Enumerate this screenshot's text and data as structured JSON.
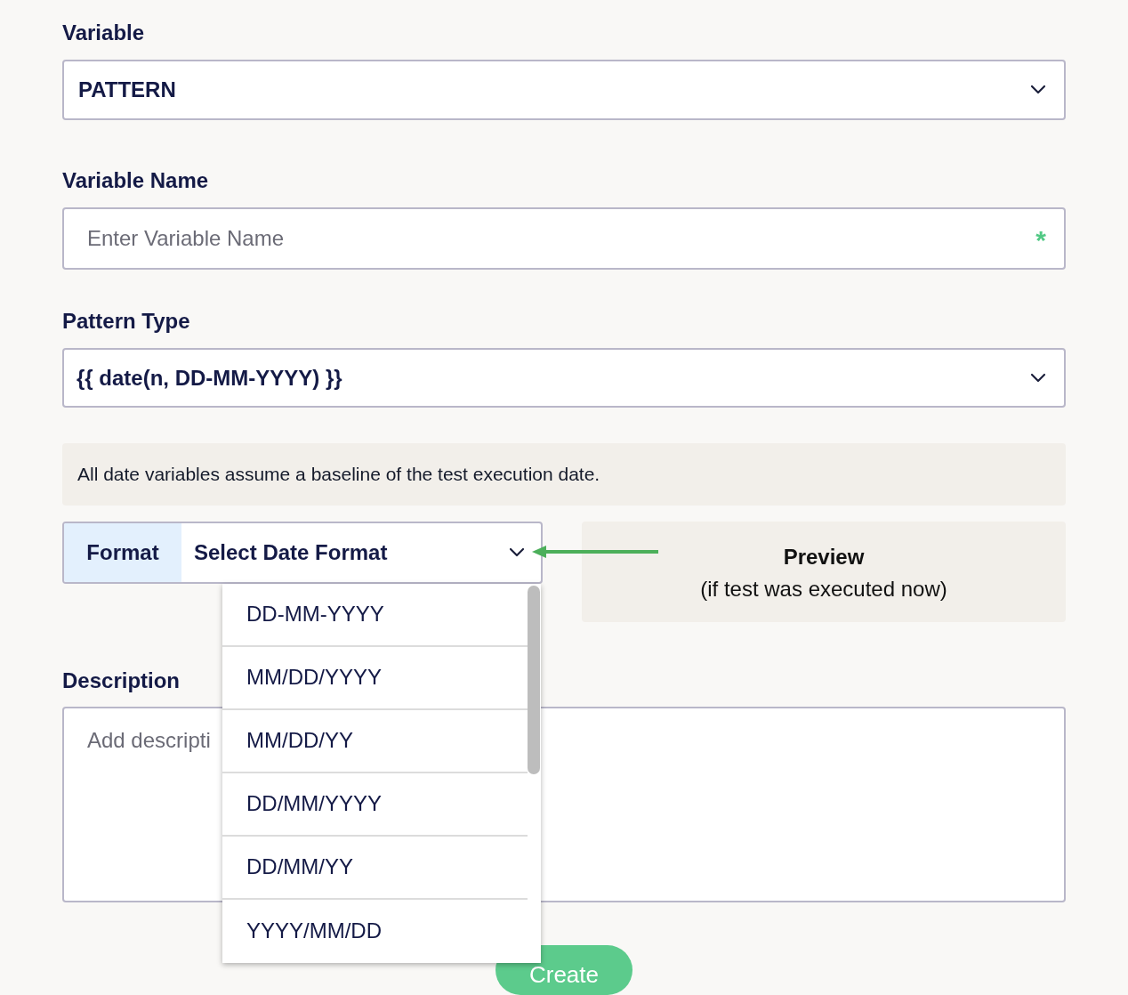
{
  "variable": {
    "label": "Variable",
    "value": "PATTERN"
  },
  "variable_name": {
    "label": "Variable Name",
    "placeholder": "Enter Variable Name",
    "required_mark": "*"
  },
  "pattern_type": {
    "label": "Pattern Type",
    "value": "{{ date(n, DD-MM-YYYY) }}"
  },
  "info": "All date variables assume a baseline of the test execution date.",
  "format": {
    "label": "Format",
    "placeholder": "Select Date Format",
    "expanded": true,
    "options": [
      "DD-MM-YYYY",
      "MM/DD/YYYY",
      "MM/DD/YY",
      "DD/MM/YYYY",
      "DD/MM/YY",
      "YYYY/MM/DD"
    ]
  },
  "preview": {
    "title": "Preview",
    "subtitle": "(if test was executed now)"
  },
  "description": {
    "label": "Description",
    "placeholder": "Add descripti"
  },
  "create_button": "Create"
}
